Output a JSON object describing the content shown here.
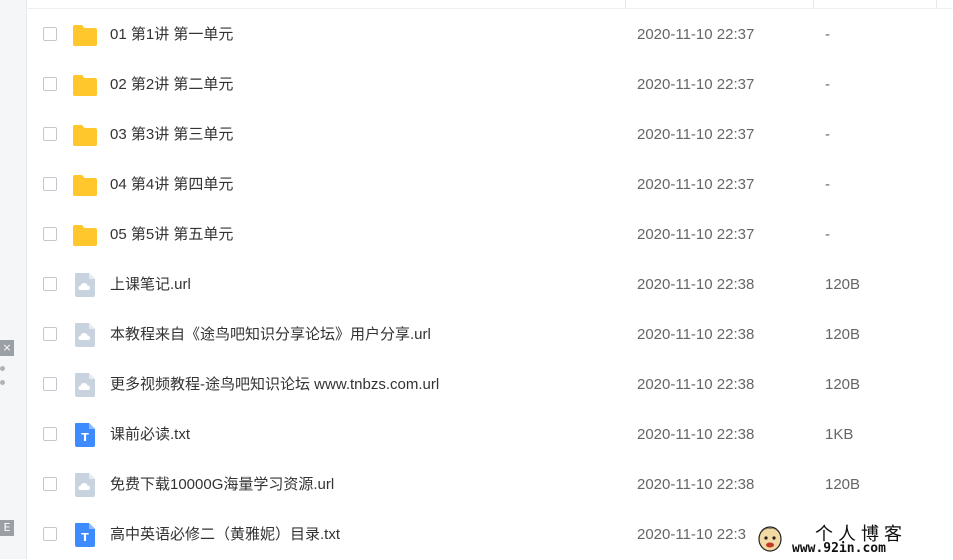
{
  "left_strip": {
    "close_glyph": "×",
    "bottom_glyph": "E"
  },
  "files": [
    {
      "name": "01 第1讲 第一单元",
      "date": "2020-11-10 22:37",
      "size": "-",
      "icon": "folder-icon"
    },
    {
      "name": "02 第2讲 第二单元",
      "date": "2020-11-10 22:37",
      "size": "-",
      "icon": "folder-icon"
    },
    {
      "name": "03 第3讲 第三单元",
      "date": "2020-11-10 22:37",
      "size": "-",
      "icon": "folder-icon"
    },
    {
      "name": "04 第4讲 第四单元",
      "date": "2020-11-10 22:37",
      "size": "-",
      "icon": "folder-icon"
    },
    {
      "name": "05 第5讲 第五单元",
      "date": "2020-11-10 22:37",
      "size": "-",
      "icon": "folder-icon"
    },
    {
      "name": "上课笔记.url",
      "date": "2020-11-10 22:38",
      "size": "120B",
      "icon": "url-file-icon"
    },
    {
      "name": "本教程来自《途鸟吧知识分享论坛》用户分享.url",
      "date": "2020-11-10 22:38",
      "size": "120B",
      "icon": "url-file-icon"
    },
    {
      "name": "更多视频教程-途鸟吧知识论坛 www.tnbzs.com.url",
      "date": "2020-11-10 22:38",
      "size": "120B",
      "icon": "url-file-icon"
    },
    {
      "name": "课前必读.txt",
      "date": "2020-11-10 22:38",
      "size": "1KB",
      "icon": "txt-file-icon"
    },
    {
      "name": "免费下载10000G海量学习资源.url",
      "date": "2020-11-10 22:38",
      "size": "120B",
      "icon": "url-file-icon"
    },
    {
      "name": "高中英语必修二（黄雅妮）目录.txt",
      "date": "2020-11-10 22:3",
      "size": "",
      "icon": "txt-file-icon"
    }
  ],
  "colors": {
    "folder": "#FFC72C",
    "url_file": "#C9D3DF",
    "txt_file": "#3D8BFF"
  },
  "txt_glyph": "T",
  "watermark": {
    "title": "个人博客",
    "url": "www.92in.com"
  }
}
